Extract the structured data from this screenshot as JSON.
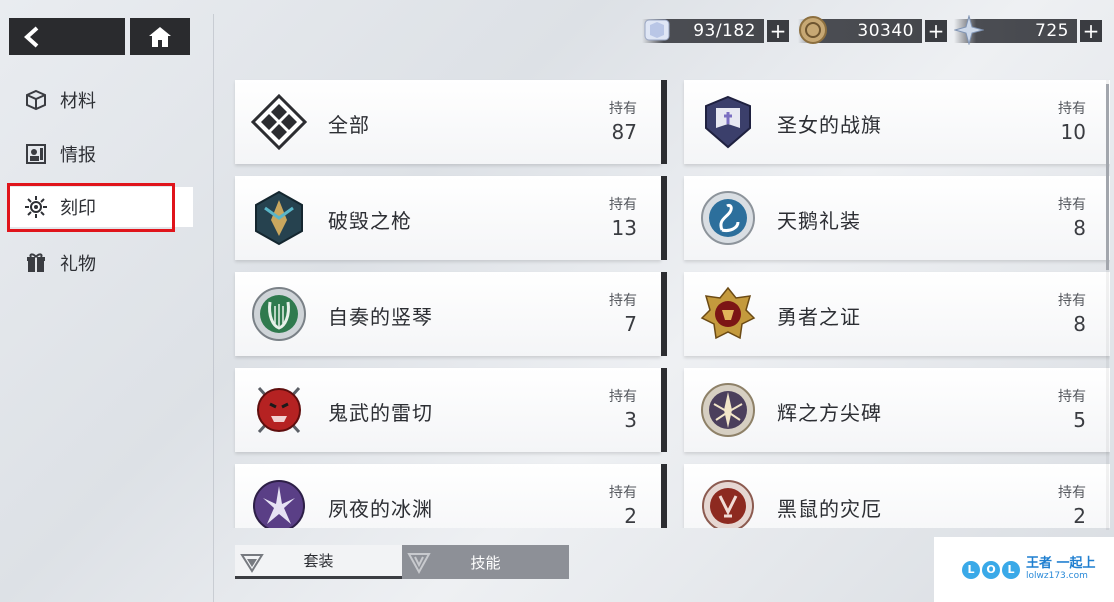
{
  "nav": {
    "back_icon": "chevron-left-icon",
    "home_icon": "home-icon"
  },
  "sidebar": {
    "items": [
      {
        "label": "材料",
        "icon": "cube-icon"
      },
      {
        "label": "情报",
        "icon": "profile-card-icon"
      },
      {
        "label": "刻印",
        "icon": "sun-emblem-icon",
        "active": true
      },
      {
        "label": "礼物",
        "icon": "gift-icon"
      }
    ]
  },
  "currencies": [
    {
      "icon": "crystal-stamina-icon",
      "value": "93/182"
    },
    {
      "icon": "coin-icon",
      "value": "30340"
    },
    {
      "icon": "star-shard-icon",
      "value": "725"
    }
  ],
  "cards": [
    {
      "name": "全部",
      "own_label": "持有",
      "count": "87"
    },
    {
      "name": "圣女的战旗",
      "own_label": "持有",
      "count": "10"
    },
    {
      "name": "破毁之枪",
      "own_label": "持有",
      "count": "13"
    },
    {
      "name": "天鹅礼装",
      "own_label": "持有",
      "count": "8"
    },
    {
      "name": "自奏的竖琴",
      "own_label": "持有",
      "count": "7"
    },
    {
      "name": "勇者之证",
      "own_label": "持有",
      "count": "8"
    },
    {
      "name": "鬼武的雷切",
      "own_label": "持有",
      "count": "3"
    },
    {
      "name": "辉之方尖碑",
      "own_label": "持有",
      "count": "5"
    },
    {
      "name": "夙夜的冰渊",
      "own_label": "持有",
      "count": "2"
    },
    {
      "name": "黑鼠的灾厄",
      "own_label": "持有",
      "count": "2"
    }
  ],
  "tabs": {
    "suit": "套装",
    "skill": "技能"
  },
  "watermark": {
    "letters": [
      "L",
      "O",
      "L"
    ],
    "title": "王者 一起上",
    "url": "lolwz173.com"
  },
  "colors": {
    "highlight": "#e0141b",
    "dark": "#2a2b2e",
    "skill_tab": "#8d9097"
  }
}
